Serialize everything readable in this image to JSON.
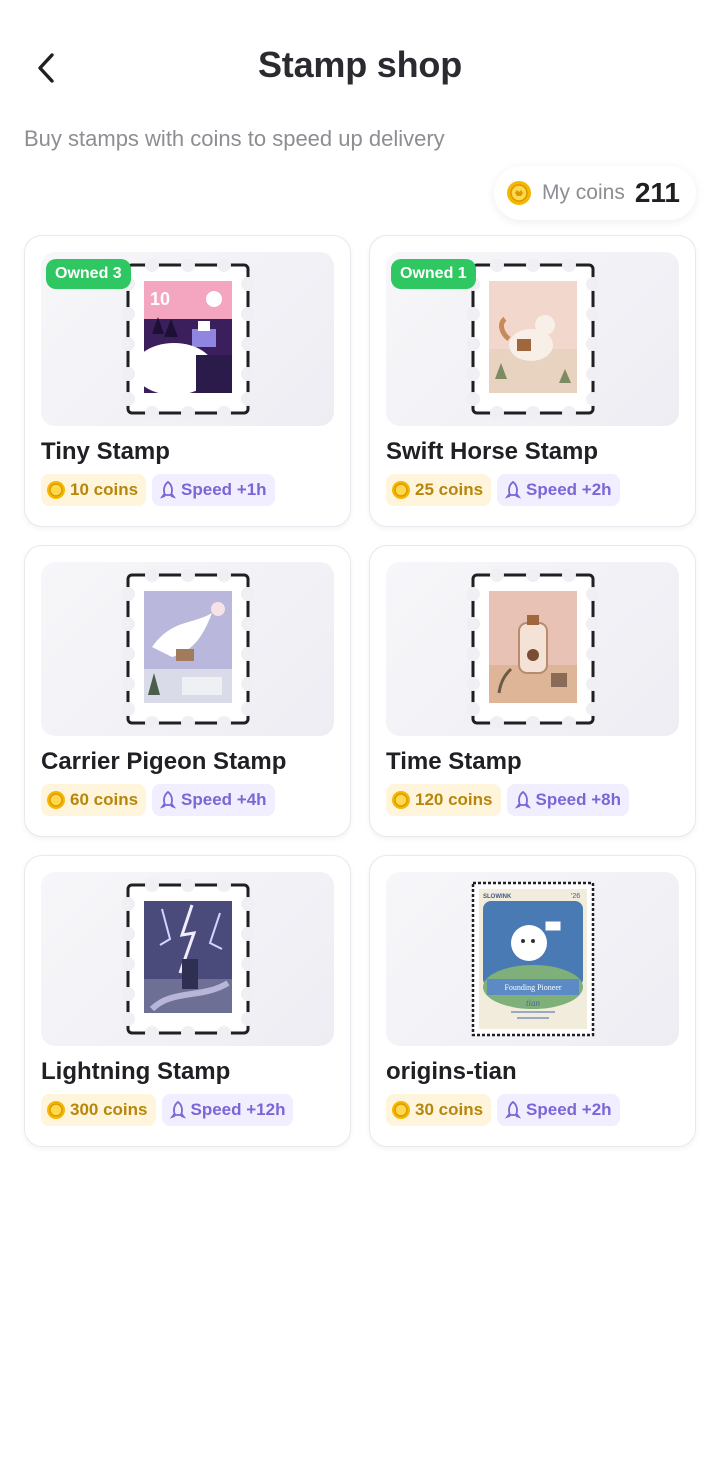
{
  "header": {
    "title": "Stamp shop",
    "subtitle": "Buy stamps with coins to speed up delivery"
  },
  "wallet": {
    "label": "My coins",
    "value": "211"
  },
  "colors": {
    "owned_badge": "#2fc761",
    "coin_tag_bg": "#fff5dd",
    "coin_text": "#b8860b",
    "speed_tag_bg": "#f1efff",
    "speed_text": "#7c65d6"
  },
  "stamps": [
    {
      "name": "Tiny Stamp",
      "owned": "Owned 3",
      "price": "10 coins",
      "speed": "Speed +1h",
      "art_text": "10",
      "art": "snow-village"
    },
    {
      "name": "Swift Horse Stamp",
      "owned": "Owned 1",
      "price": "25 coins",
      "speed": "Speed +2h",
      "art": "horse"
    },
    {
      "name": "Carrier Pigeon Stamp",
      "price": "60 coins",
      "speed": "Speed +4h",
      "art": "pigeon"
    },
    {
      "name": "Time Stamp",
      "price": "120 coins",
      "speed": "Speed +8h",
      "art": "bottle"
    },
    {
      "name": "Lightning Stamp",
      "price": "300 coins",
      "speed": "Speed +12h",
      "art": "lightning"
    },
    {
      "name": "origins-tian",
      "price": "30 coins",
      "speed": "Speed +2h",
      "art": "pioneer",
      "art_brand": "SLOWINK",
      "art_year": "'26",
      "art_banner": "Founding Pioneer",
      "art_sign": "tian"
    }
  ],
  "icons": {
    "back": "chevron-left-icon",
    "coin": "coin-icon",
    "speed": "rocket-icon"
  }
}
